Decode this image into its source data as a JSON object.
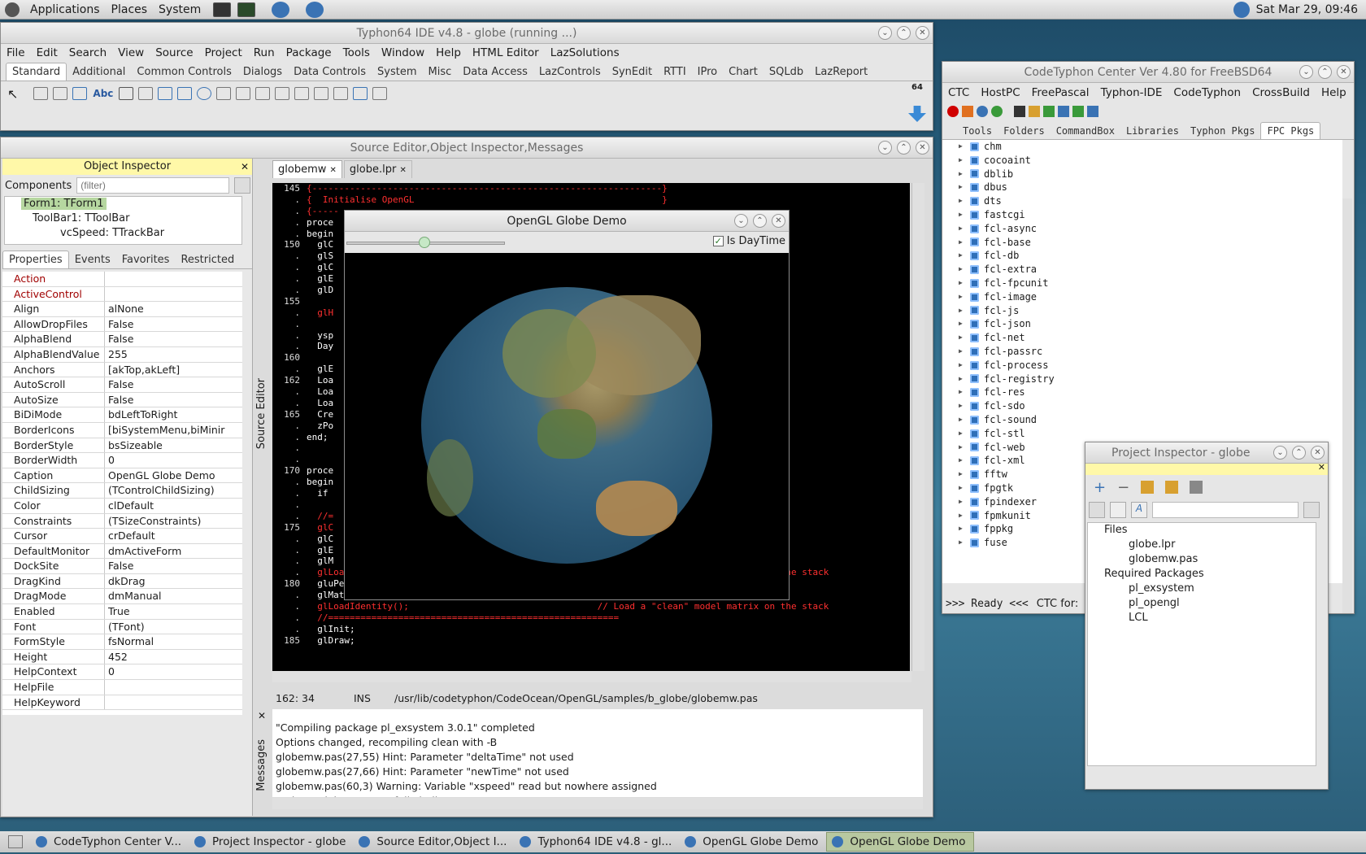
{
  "topbar": {
    "menus": [
      "Applications",
      "Places",
      "System"
    ],
    "clock": "Sat Mar 29, 09:46"
  },
  "ide": {
    "title": "Typhon64 IDE v4.8 - globe (running ...)",
    "menu": [
      "File",
      "Edit",
      "Search",
      "View",
      "Source",
      "Project",
      "Run",
      "Package",
      "Tools",
      "Window",
      "Help",
      "HTML Editor",
      "LazSolutions"
    ],
    "palette_tabs": [
      "Standard",
      "Additional",
      "Common Controls",
      "Dialogs",
      "Data Controls",
      "System",
      "Misc",
      "Data Access",
      "LazControls",
      "SynEdit",
      "RTTI",
      "IPro",
      "Chart",
      "SQLdb",
      "LazReport"
    ],
    "badge": "64"
  },
  "editor": {
    "title": "Source Editor,Object Inspector,Messages",
    "tabs": [
      "globemw",
      "globe.lpr"
    ],
    "side_label": "Source Editor",
    "status": {
      "pos": "162: 34",
      "mode": "INS",
      "file": "/usr/lib/codetyphon/CodeOcean/OpenGL/samples/b_globe/globemw.pas"
    },
    "lines": [
      {
        "n": "145",
        "t": "{-----------------------------------------------------------------}"
      },
      {
        "n": ".",
        "t": "{  Initialise OpenGL                                              }"
      },
      {
        "n": ".",
        "t": "{-----"
      },
      {
        "n": ".",
        "t": "proce"
      },
      {
        "n": ".",
        "t": "begin"
      },
      {
        "n": "150",
        "t": "  glC"
      },
      {
        "n": ".",
        "t": "  glS"
      },
      {
        "n": ".",
        "t": "  glC"
      },
      {
        "n": ".",
        "t": "  glE"
      },
      {
        "n": ".",
        "t": "  glD"
      },
      {
        "n": "155",
        "t": ""
      },
      {
        "n": ".",
        "t": "  glH                                                              culations"
      },
      {
        "n": ".",
        "t": ""
      },
      {
        "n": ".",
        "t": "  ysp"
      },
      {
        "n": ".",
        "t": "  Day"
      },
      {
        "n": "160",
        "t": ""
      },
      {
        "n": ".",
        "t": "  glE"
      },
      {
        "n": "162",
        "t": "  Loa"
      },
      {
        "n": ".",
        "t": "  Loa"
      },
      {
        "n": ".",
        "t": "  Loa"
      },
      {
        "n": "165",
        "t": "  Cre"
      },
      {
        "n": ".",
        "t": "  zPo"
      },
      {
        "n": ".",
        "t": "end;"
      },
      {
        "n": ".",
        "t": ""
      },
      {
        "n": ".",
        "t": ""
      },
      {
        "n": "170",
        "t": "proce"
      },
      {
        "n": ".",
        "t": "begin"
      },
      {
        "n": ".",
        "t": "  if"
      },
      {
        "n": ".",
        "t": ""
      },
      {
        "n": ".",
        "t": "  //=                                                              =================="
      },
      {
        "n": "175",
        "t": "  glC                                                              ur of or scene"
      },
      {
        "n": ".",
        "t": "  glC"
      },
      {
        "n": ".",
        "t": "  glE"
      },
      {
        "n": ".",
        "t": "  glM"
      },
      {
        "n": ".",
        "t": "  glLoadIdentity();                                   // Load a \"clean\" model matrix on the stack"
      },
      {
        "n": "180",
        "t": "  gluPerspective(45.0, width/height, 0.1, 100.0);"
      },
      {
        "n": ".",
        "t": "  glMatrixMode(GL_MODELVIEW);"
      },
      {
        "n": ".",
        "t": "  glLoadIdentity();                                   // Load a \"clean\" model matrix on the stack"
      },
      {
        "n": ".",
        "t": "  //======================================================"
      },
      {
        "n": ".",
        "t": "  glInit;"
      },
      {
        "n": "185",
        "t": "  glDraw;"
      }
    ]
  },
  "oi": {
    "title": "Object Inspector",
    "components_label": "Components",
    "filter_placeholder": "(filter)",
    "tree": [
      "Form1: TForm1",
      "ToolBar1: TToolBar",
      "vcSpeed: TTrackBar"
    ],
    "tabs": [
      "Properties",
      "Events",
      "Favorites",
      "Restricted"
    ],
    "props": [
      {
        "k": "Action",
        "v": "",
        "red": true
      },
      {
        "k": "ActiveControl",
        "v": "",
        "red": true
      },
      {
        "k": "Align",
        "v": "alNone"
      },
      {
        "k": "AllowDropFiles",
        "v": "False"
      },
      {
        "k": "AlphaBlend",
        "v": "False"
      },
      {
        "k": "AlphaBlendValue",
        "v": "255"
      },
      {
        "k": "Anchors",
        "v": "[akTop,akLeft]"
      },
      {
        "k": "AutoScroll",
        "v": "False"
      },
      {
        "k": "AutoSize",
        "v": "False"
      },
      {
        "k": "BiDiMode",
        "v": "bdLeftToRight"
      },
      {
        "k": "BorderIcons",
        "v": "[biSystemMenu,biMinir"
      },
      {
        "k": "BorderStyle",
        "v": "bsSizeable"
      },
      {
        "k": "BorderWidth",
        "v": "0"
      },
      {
        "k": "Caption",
        "v": "OpenGL Globe Demo"
      },
      {
        "k": "ChildSizing",
        "v": "(TControlChildSizing)"
      },
      {
        "k": "Color",
        "v": "clDefault"
      },
      {
        "k": "Constraints",
        "v": "(TSizeConstraints)"
      },
      {
        "k": "Cursor",
        "v": "crDefault"
      },
      {
        "k": "DefaultMonitor",
        "v": "dmActiveForm"
      },
      {
        "k": "DockSite",
        "v": "False"
      },
      {
        "k": "DragKind",
        "v": "dkDrag"
      },
      {
        "k": "DragMode",
        "v": "dmManual"
      },
      {
        "k": "Enabled",
        "v": "True"
      },
      {
        "k": "Font",
        "v": "(TFont)"
      },
      {
        "k": "FormStyle",
        "v": "fsNormal"
      },
      {
        "k": "Height",
        "v": "452"
      },
      {
        "k": "HelpContext",
        "v": "0"
      },
      {
        "k": "HelpFile",
        "v": ""
      },
      {
        "k": "HelpKeyword",
        "v": ""
      }
    ]
  },
  "messages": {
    "label": "Messages",
    "lines": [
      "\"Compiling package pl_exsystem 3.0.1\" completed",
      "Options changed, recompiling clean with -B",
      "globemw.pas(27,55) Hint: Parameter \"deltaTime\" not used",
      "globemw.pas(27,66) Hint: Parameter \"newTime\" not used",
      "globemw.pas(60,3) Warning: Variable \"xspeed\" read but nowhere assigned",
      "Project \"globe\" successfully built"
    ]
  },
  "globe": {
    "title": "OpenGL Globe Demo",
    "daytime_label": "Is DayTime"
  },
  "ctc": {
    "title": "CodeTyphon Center Ver 4.80 for FreeBSD64",
    "menu": [
      "CTC",
      "HostPC",
      "FreePascal",
      "Typhon-IDE",
      "CodeTyphon",
      "CrossBuild",
      "Help"
    ],
    "tabs": [
      "Tools",
      "Folders",
      "CommandBox",
      "Libraries",
      "Typhon Pkgs",
      "FPC Pkgs"
    ],
    "packages": [
      "chm",
      "cocoaint",
      "dblib",
      "dbus",
      "dts",
      "fastcgi",
      "fcl-async",
      "fcl-base",
      "fcl-db",
      "fcl-extra",
      "fcl-fpcunit",
      "fcl-image",
      "fcl-js",
      "fcl-json",
      "fcl-net",
      "fcl-passrc",
      "fcl-process",
      "fcl-registry",
      "fcl-res",
      "fcl-sdo",
      "fcl-sound",
      "fcl-stl",
      "fcl-web",
      "fcl-xml",
      "fftw",
      "fpgtk",
      "fpindexer",
      "fpmkunit",
      "fppkg",
      "fuse"
    ],
    "status": ">>> Ready <<<",
    "status2": "CTC for:"
  },
  "pi": {
    "title": "Project Inspector - globe",
    "files_label": "Files",
    "files": [
      "globe.lpr",
      "globemw.pas"
    ],
    "req_label": "Required Packages",
    "reqs": [
      "pl_exsystem",
      "pl_opengl",
      "LCL"
    ]
  },
  "taskbar": [
    "CodeTyphon Center V...",
    "Project Inspector - globe",
    "Source Editor,Object I...",
    "Typhon64 IDE v4.8 - gl...",
    "OpenGL Globe Demo",
    "OpenGL Globe Demo"
  ],
  "colors": {
    "accent": "#3a73b4",
    "error": "#d00000",
    "highlight": "#fff8a8"
  }
}
